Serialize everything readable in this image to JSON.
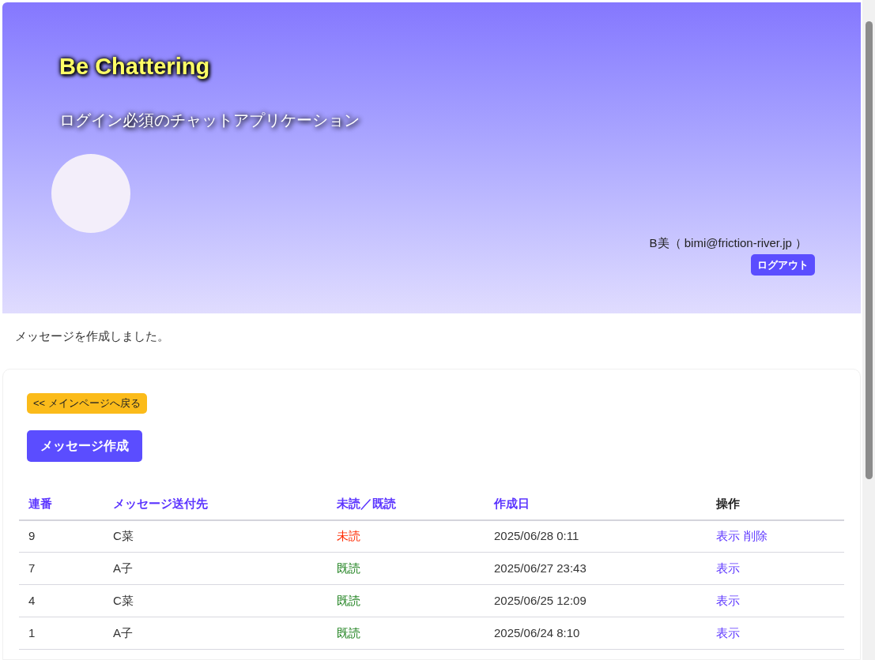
{
  "header": {
    "title": "Be Chattering",
    "subtitle": "ログイン必須のチャットアプリケーション",
    "user": "B美（ bimi@friction-river.jp ）",
    "logout": "ログアウト"
  },
  "flash": "メッセージを作成しました。",
  "back_button": "<< メインページへ戻る",
  "create_button": "メッセージ作成",
  "table": {
    "columns": [
      {
        "label": "連番",
        "kind": "link"
      },
      {
        "label": "メッセージ送付先",
        "kind": "link"
      },
      {
        "label": "未読／既読",
        "kind": "link"
      },
      {
        "label": "作成日",
        "kind": "link"
      },
      {
        "label": "操作",
        "kind": "plain"
      }
    ],
    "rows": [
      {
        "no": "9",
        "to": "C菜",
        "status": "未読",
        "read": false,
        "created": "2025/06/28 0:11",
        "actions": [
          "表示",
          "削除"
        ]
      },
      {
        "no": "7",
        "to": "A子",
        "status": "既読",
        "read": true,
        "created": "2025/06/27 23:43",
        "actions": [
          "表示"
        ]
      },
      {
        "no": "4",
        "to": "C菜",
        "status": "既読",
        "read": true,
        "created": "2025/06/25 12:09",
        "actions": [
          "表示"
        ]
      },
      {
        "no": "1",
        "to": "A子",
        "status": "既読",
        "read": true,
        "created": "2025/06/24 8:10",
        "actions": [
          "表示"
        ]
      }
    ]
  }
}
